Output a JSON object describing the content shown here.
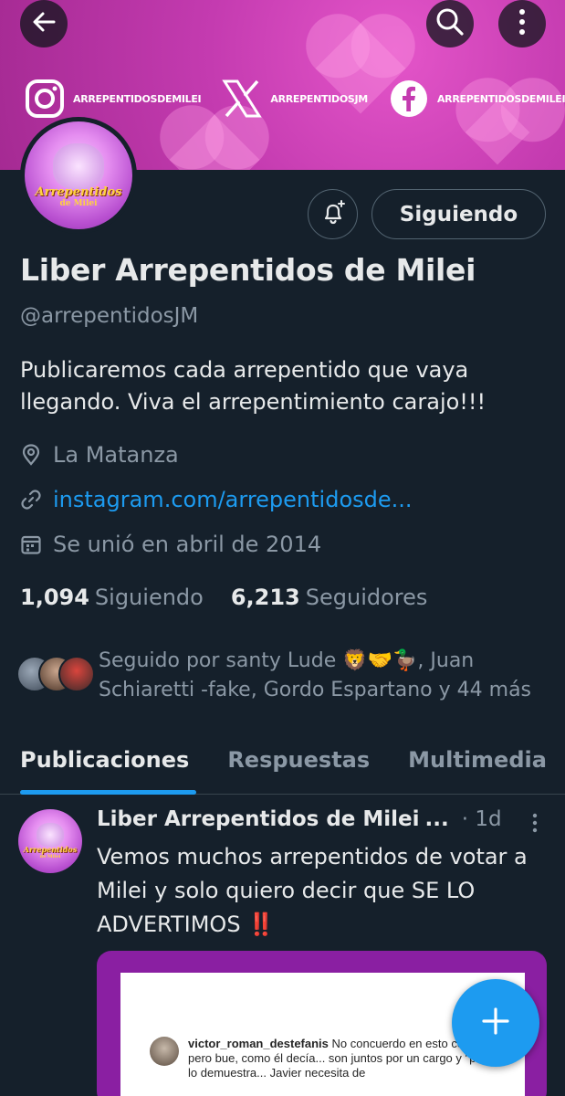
{
  "banner": {
    "socials": [
      {
        "icon": "instagram-icon",
        "handle": "ARREPENTIDOSDEMILEI"
      },
      {
        "icon": "x-logo-icon",
        "handle": "ARREPENTIDOSJM"
      },
      {
        "icon": "facebook-icon",
        "handle": "ARREPENTIDOSDEMILEI"
      }
    ]
  },
  "avatar": {
    "title": "Arrepentidos",
    "subtitle": "de Milei"
  },
  "actions": {
    "follow_label": "Siguiendo"
  },
  "profile": {
    "name": "Liber Arrepentidos de Milei",
    "handle": "@arrepentidosJM",
    "bio": "Publicaremos cada arrepentido que vaya llegando. Viva el arrepentimiento carajo!!!",
    "location": "La Matanza",
    "link": "instagram.com/arrepentidosde...",
    "joined": "Se unió en abril de 2014"
  },
  "stats": {
    "following_count": "1,094",
    "following_label": "Siguiendo",
    "followers_count": "6,213",
    "followers_label": "Seguidores"
  },
  "followed_by": "Seguido por santy Lude 🦁🤝🦆, Juan Schiaretti -fake, Gordo Espartano y 44 más",
  "tabs": [
    "Publicaciones",
    "Respuestas",
    "Multimedia"
  ],
  "post": {
    "author": "Liber Arrepentidos de Milei",
    "ellipsis": "...",
    "time": "· 1d",
    "text": "Vemos muchos arrepentidos de votar a Milei y solo quiero decir que SE LO ADVERTIMOS",
    "emoji": "‼️",
    "media": {
      "comment_user": "victor_roman_destefanis",
      "comment_text": "No concuerdo en esto con Milei... pero bue, como él decía... son juntos por un cargo y \"pato\" así lo demuestra... Javier necesita de"
    }
  },
  "colors": {
    "accent": "#1d9bf0",
    "background": "#15202b",
    "muted": "#8b98a5",
    "banner": "#c43bb0"
  }
}
